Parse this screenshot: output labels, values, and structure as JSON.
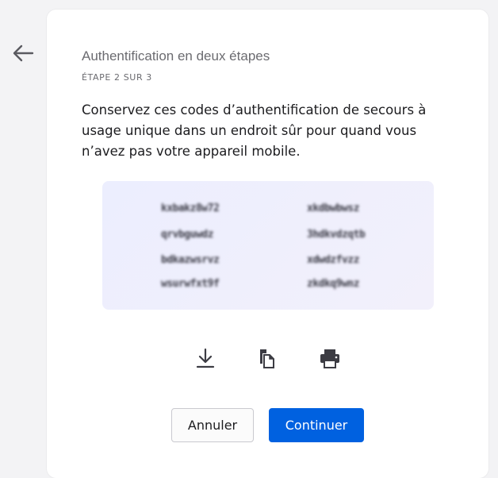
{
  "header": {
    "back_icon": "arrow-left-icon",
    "title": "Authentification en deux étapes",
    "step": "ÉTAPE 2 SUR 3"
  },
  "main": {
    "description": "Conservez ces codes d’authentification de secours à usage unique dans un endroit sûr pour quand vous n’avez pas votre appareil mobile.",
    "codes": [
      "kxbakz8w72",
      "qrvbguwdz",
      "bdkazwsrvz",
      "wsurwfxt9f",
      "xkdbwbwsz",
      "3hdkvdzqtb",
      "xdwdzfvzz",
      "zkdkq9wnz"
    ],
    "actions": [
      {
        "icon": "download-icon"
      },
      {
        "icon": "copy-icon"
      },
      {
        "icon": "print-icon"
      }
    ]
  },
  "footer": {
    "cancel_label": "Annuler",
    "continue_label": "Continuer"
  },
  "colors": {
    "accent": "#0061e0",
    "codes_background": "#eef0fd",
    "page_background": "#f3f3f5"
  }
}
